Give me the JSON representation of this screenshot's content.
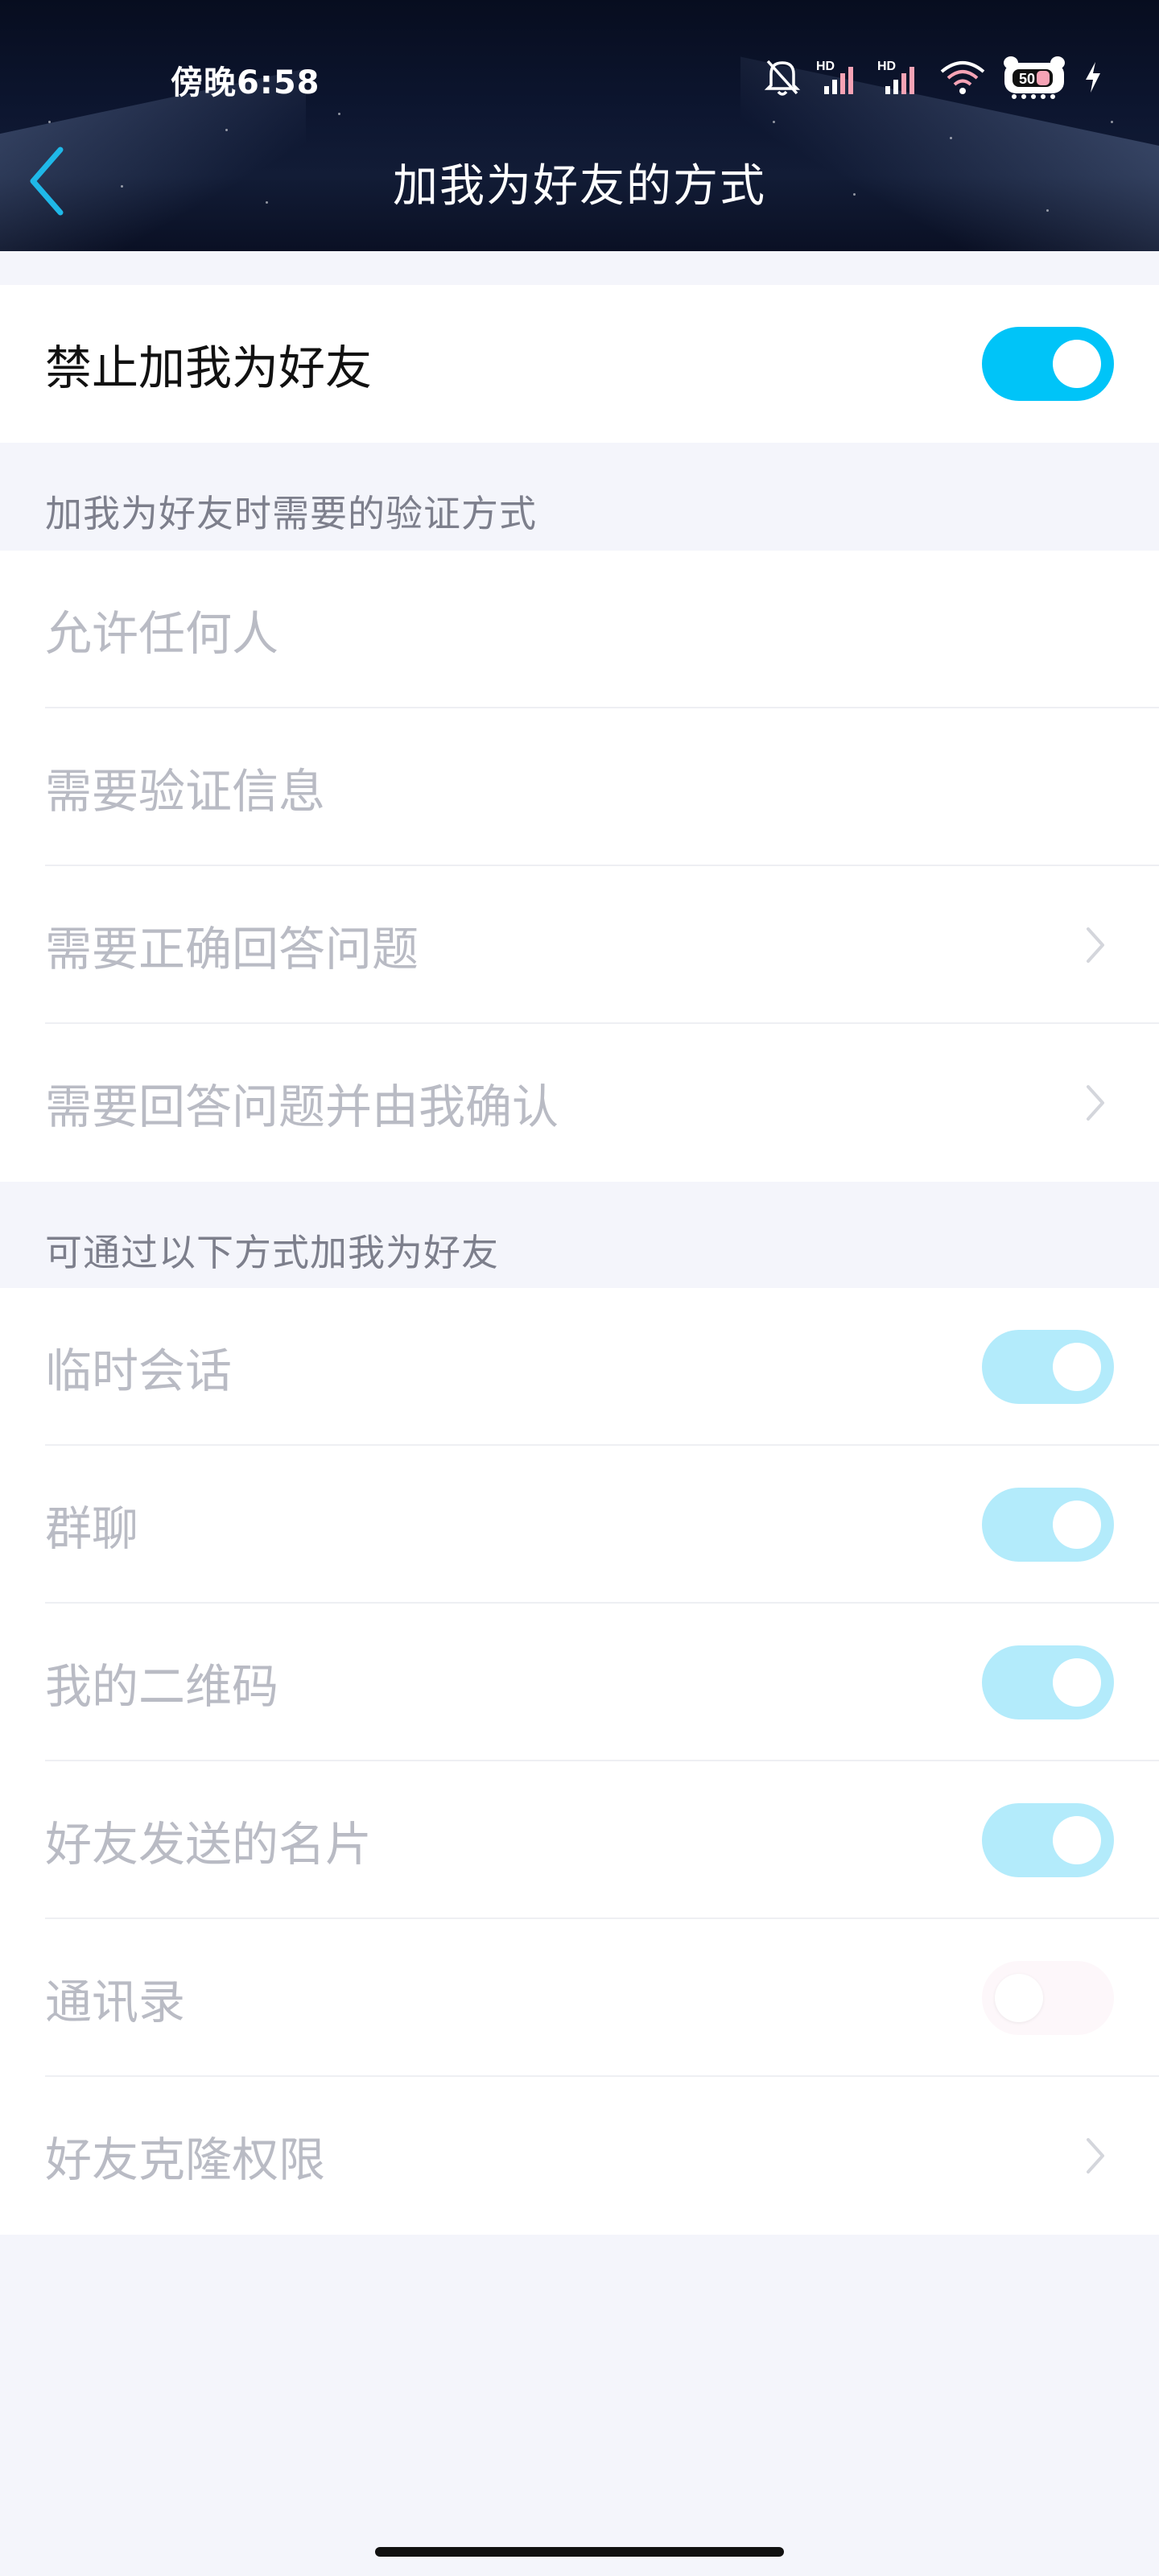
{
  "status_bar": {
    "time": "傍晚6:58",
    "battery_level": "50"
  },
  "nav": {
    "title": "加我为好友的方式"
  },
  "top": {
    "block_label": "禁止加我为好友"
  },
  "verification": {
    "header": "加我为好友时需要的验证方式",
    "options": [
      {
        "label": "允许任何人"
      },
      {
        "label": "需要验证信息"
      },
      {
        "label": "需要正确回答问题"
      },
      {
        "label": "需要回答问题并由我确认"
      }
    ]
  },
  "channels": {
    "header": "可通过以下方式加我为好友",
    "items": [
      {
        "label": "临时会话"
      },
      {
        "label": "群聊"
      },
      {
        "label": "我的二维码"
      },
      {
        "label": "好友发送的名片"
      },
      {
        "label": "通讯录"
      },
      {
        "label": "好友克隆权限"
      }
    ]
  },
  "colors": {
    "toggle_on": "#00c4f8",
    "toggle_disabled_on": "#b3ebfb",
    "back_arrow": "#1fb8e8",
    "page_background": "#f4f5fb"
  },
  "icons": {
    "back": "chevron-left-icon",
    "chevron": "chevron-right-icon",
    "mute": "bell-off-icon",
    "signal": "signal-hd-icon",
    "wifi": "wifi-icon",
    "battery": "battery-icon",
    "charging": "bolt-icon"
  }
}
